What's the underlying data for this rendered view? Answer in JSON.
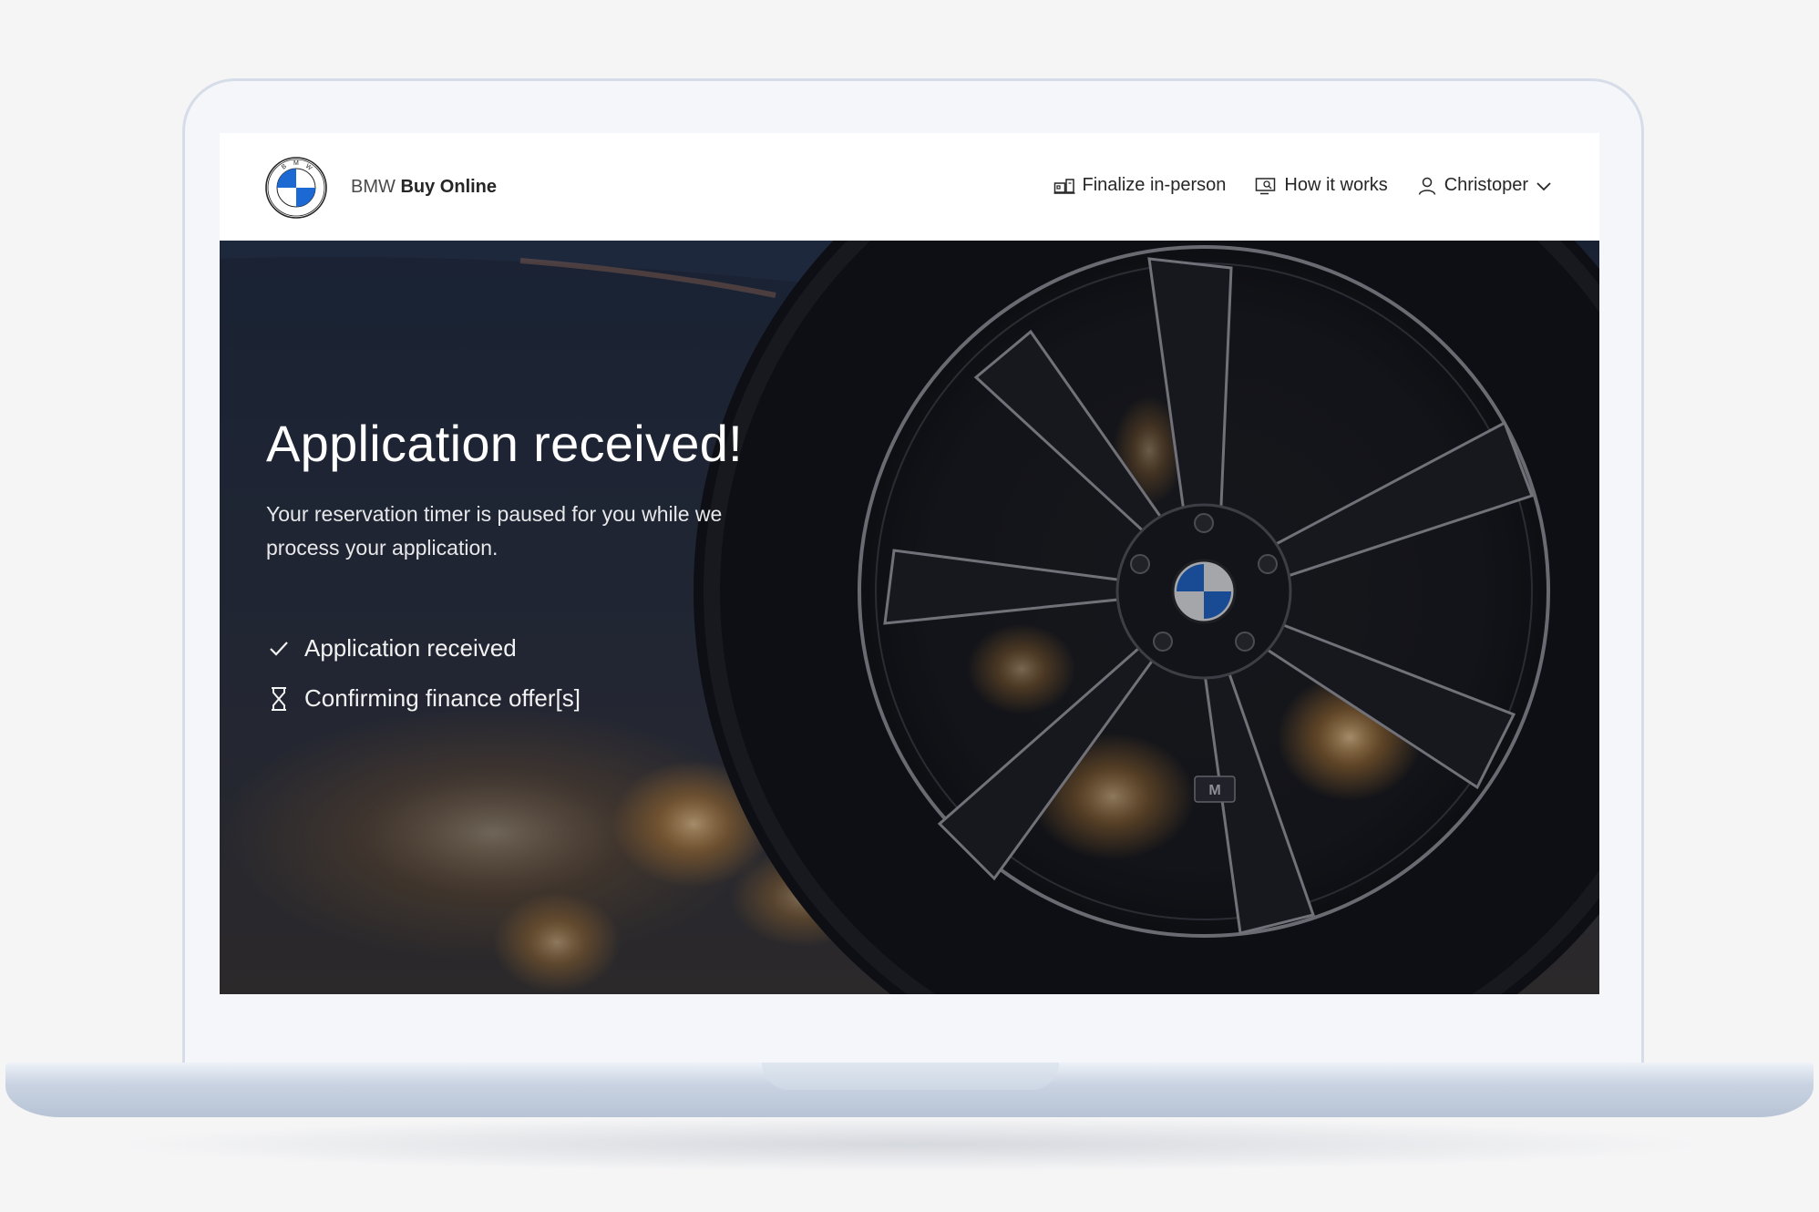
{
  "header": {
    "brand_prefix": "BMW",
    "brand_name": "Buy Online",
    "logo_letters": [
      "B",
      "M",
      "W"
    ],
    "nav": {
      "finalize_label": "Finalize in-person",
      "how_it_works_label": "How it works",
      "user_label": "Christoper"
    }
  },
  "hero": {
    "title": "Application received!",
    "subtitle": "Your reservation timer is paused for you while we process your application.",
    "status_items": [
      {
        "label": "Application received",
        "icon": "checkmark-icon"
      },
      {
        "label": "Confirming finance offer[s]",
        "icon": "hourglass-icon"
      }
    ],
    "wheel_badge": "M"
  },
  "colors": {
    "bmw_blue": "#1c69d4",
    "text_dark": "#262626",
    "hero_text": "#ffffff"
  }
}
